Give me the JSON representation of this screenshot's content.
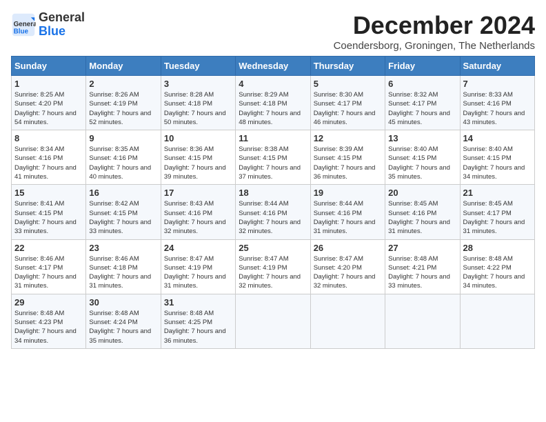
{
  "logo": {
    "general": "General",
    "blue": "Blue"
  },
  "title": "December 2024",
  "subtitle": "Coendersborg, Groningen, The Netherlands",
  "days_of_week": [
    "Sunday",
    "Monday",
    "Tuesday",
    "Wednesday",
    "Thursday",
    "Friday",
    "Saturday"
  ],
  "weeks": [
    [
      {
        "day": "1",
        "sunrise": "8:25 AM",
        "sunset": "4:20 PM",
        "daylight": "7 hours and 54 minutes."
      },
      {
        "day": "2",
        "sunrise": "8:26 AM",
        "sunset": "4:19 PM",
        "daylight": "7 hours and 52 minutes."
      },
      {
        "day": "3",
        "sunrise": "8:28 AM",
        "sunset": "4:18 PM",
        "daylight": "7 hours and 50 minutes."
      },
      {
        "day": "4",
        "sunrise": "8:29 AM",
        "sunset": "4:18 PM",
        "daylight": "7 hours and 48 minutes."
      },
      {
        "day": "5",
        "sunrise": "8:30 AM",
        "sunset": "4:17 PM",
        "daylight": "7 hours and 46 minutes."
      },
      {
        "day": "6",
        "sunrise": "8:32 AM",
        "sunset": "4:17 PM",
        "daylight": "7 hours and 45 minutes."
      },
      {
        "day": "7",
        "sunrise": "8:33 AM",
        "sunset": "4:16 PM",
        "daylight": "7 hours and 43 minutes."
      }
    ],
    [
      {
        "day": "8",
        "sunrise": "8:34 AM",
        "sunset": "4:16 PM",
        "daylight": "7 hours and 41 minutes."
      },
      {
        "day": "9",
        "sunrise": "8:35 AM",
        "sunset": "4:16 PM",
        "daylight": "7 hours and 40 minutes."
      },
      {
        "day": "10",
        "sunrise": "8:36 AM",
        "sunset": "4:15 PM",
        "daylight": "7 hours and 39 minutes."
      },
      {
        "day": "11",
        "sunrise": "8:38 AM",
        "sunset": "4:15 PM",
        "daylight": "7 hours and 37 minutes."
      },
      {
        "day": "12",
        "sunrise": "8:39 AM",
        "sunset": "4:15 PM",
        "daylight": "7 hours and 36 minutes."
      },
      {
        "day": "13",
        "sunrise": "8:40 AM",
        "sunset": "4:15 PM",
        "daylight": "7 hours and 35 minutes."
      },
      {
        "day": "14",
        "sunrise": "8:40 AM",
        "sunset": "4:15 PM",
        "daylight": "7 hours and 34 minutes."
      }
    ],
    [
      {
        "day": "15",
        "sunrise": "8:41 AM",
        "sunset": "4:15 PM",
        "daylight": "7 hours and 33 minutes."
      },
      {
        "day": "16",
        "sunrise": "8:42 AM",
        "sunset": "4:15 PM",
        "daylight": "7 hours and 33 minutes."
      },
      {
        "day": "17",
        "sunrise": "8:43 AM",
        "sunset": "4:16 PM",
        "daylight": "7 hours and 32 minutes."
      },
      {
        "day": "18",
        "sunrise": "8:44 AM",
        "sunset": "4:16 PM",
        "daylight": "7 hours and 32 minutes."
      },
      {
        "day": "19",
        "sunrise": "8:44 AM",
        "sunset": "4:16 PM",
        "daylight": "7 hours and 31 minutes."
      },
      {
        "day": "20",
        "sunrise": "8:45 AM",
        "sunset": "4:16 PM",
        "daylight": "7 hours and 31 minutes."
      },
      {
        "day": "21",
        "sunrise": "8:45 AM",
        "sunset": "4:17 PM",
        "daylight": "7 hours and 31 minutes."
      }
    ],
    [
      {
        "day": "22",
        "sunrise": "8:46 AM",
        "sunset": "4:17 PM",
        "daylight": "7 hours and 31 minutes."
      },
      {
        "day": "23",
        "sunrise": "8:46 AM",
        "sunset": "4:18 PM",
        "daylight": "7 hours and 31 minutes."
      },
      {
        "day": "24",
        "sunrise": "8:47 AM",
        "sunset": "4:19 PM",
        "daylight": "7 hours and 31 minutes."
      },
      {
        "day": "25",
        "sunrise": "8:47 AM",
        "sunset": "4:19 PM",
        "daylight": "7 hours and 32 minutes."
      },
      {
        "day": "26",
        "sunrise": "8:47 AM",
        "sunset": "4:20 PM",
        "daylight": "7 hours and 32 minutes."
      },
      {
        "day": "27",
        "sunrise": "8:48 AM",
        "sunset": "4:21 PM",
        "daylight": "7 hours and 33 minutes."
      },
      {
        "day": "28",
        "sunrise": "8:48 AM",
        "sunset": "4:22 PM",
        "daylight": "7 hours and 34 minutes."
      }
    ],
    [
      {
        "day": "29",
        "sunrise": "8:48 AM",
        "sunset": "4:23 PM",
        "daylight": "7 hours and 34 minutes."
      },
      {
        "day": "30",
        "sunrise": "8:48 AM",
        "sunset": "4:24 PM",
        "daylight": "7 hours and 35 minutes."
      },
      {
        "day": "31",
        "sunrise": "8:48 AM",
        "sunset": "4:25 PM",
        "daylight": "7 hours and 36 minutes."
      },
      null,
      null,
      null,
      null
    ]
  ]
}
